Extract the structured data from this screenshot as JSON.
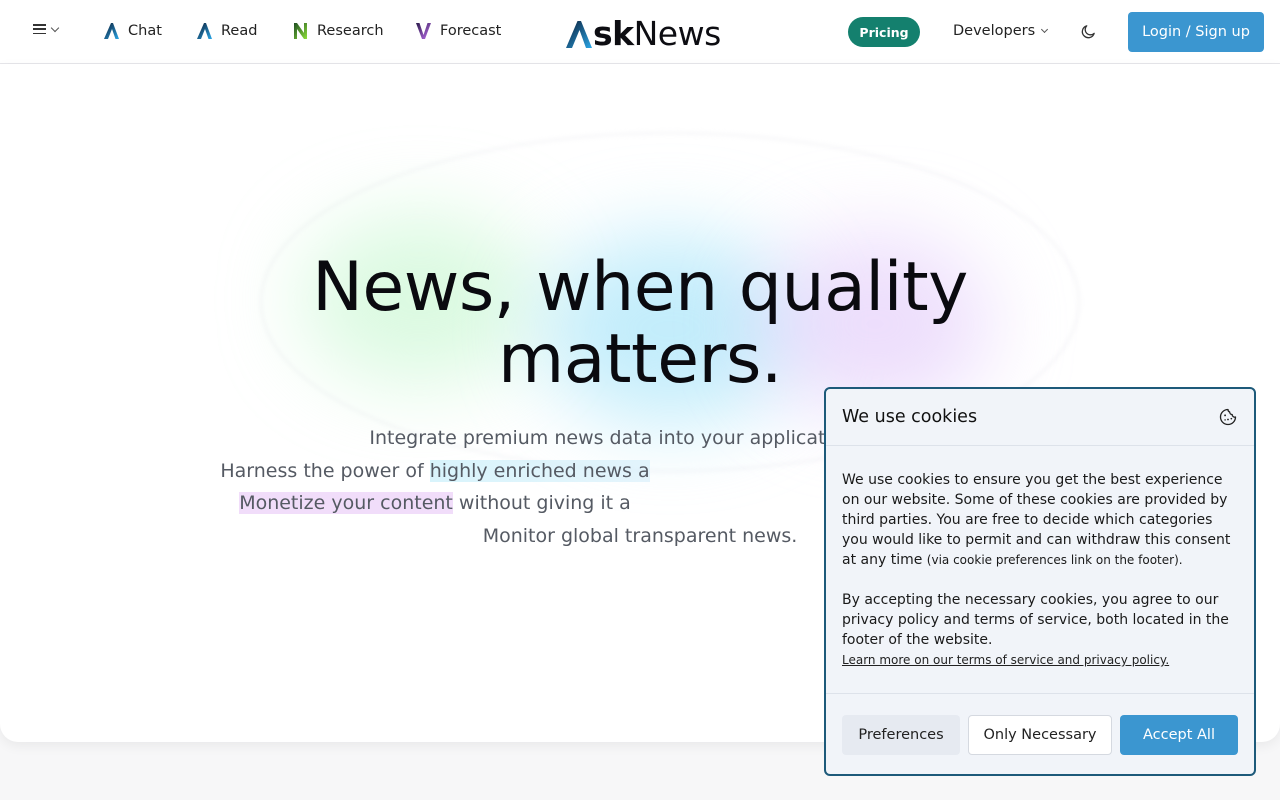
{
  "header": {
    "menu_icon": "hamburger-icon",
    "nav": [
      {
        "label": "Chat",
        "icon": "asknews-a-icon"
      },
      {
        "label": "Read",
        "icon": "asknews-a-icon"
      },
      {
        "label": "Research",
        "icon": "research-n-icon"
      },
      {
        "label": "Forecast",
        "icon": "forecast-v-icon"
      }
    ],
    "logo": {
      "bold": "sk",
      "light": "News"
    },
    "pricing_label": "Pricing",
    "developers_label": "Developers",
    "theme_icon": "moon-icon",
    "login_label": "Login / Sign up"
  },
  "hero": {
    "headline_line1": "News, when quality",
    "headline_line2": "matters.",
    "line1": "Integrate premium news data into your applications with",
    "line2_pre": "Harness the power of",
    "line2_highlight": "highly enriched news a",
    "line3_highlight": "Monetize your content",
    "line3_post": "without giving it a",
    "line4": "Monitor global transparent news."
  },
  "cookies": {
    "title": "We use cookies",
    "icon": "cookie-icon",
    "para1": "We use cookies to ensure you get the best experience on our website. Some of these cookies are provided by third parties. You are free to decide which categories you would like to permit and can withdraw this consent at any time",
    "para1_small": "(via cookie preferences link on the footer).",
    "para2": "By accepting the necessary cookies, you agree to our privacy policy and terms of service, both located in the footer of the website.",
    "learn_more": "Learn more on our terms of service and privacy policy.",
    "btn_preferences": "Preferences",
    "btn_necessary": "Only Necessary",
    "btn_accept": "Accept All"
  },
  "colors": {
    "pricing_bg": "#14806e",
    "login_bg": "#3b96d0",
    "cookie_border": "#1d5a7a"
  }
}
